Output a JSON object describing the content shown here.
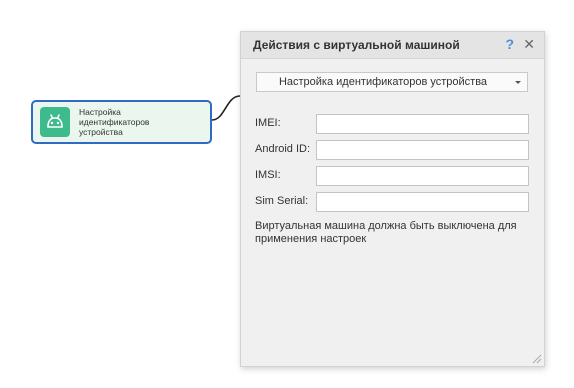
{
  "node": {
    "label": "Настройка\nидентификаторов\nустройства",
    "icon": "android-icon",
    "accent_color": "#3dbb8d",
    "border_color": "#2f6bc4"
  },
  "dialog": {
    "title": "Действия с виртуальной машиной",
    "help_label": "?",
    "close_label": "✕",
    "action_select": {
      "value": "Настройка идентификаторов устройства"
    },
    "fields": [
      {
        "key": "imei",
        "label": "IMEI:",
        "value": ""
      },
      {
        "key": "android_id",
        "label": "Android ID:",
        "value": ""
      },
      {
        "key": "imsi",
        "label": "IMSI:",
        "value": ""
      },
      {
        "key": "sim_serial",
        "label": "Sim Serial:",
        "value": ""
      }
    ],
    "note": "Виртуальная машина должна быть выключена для применения настроек"
  }
}
